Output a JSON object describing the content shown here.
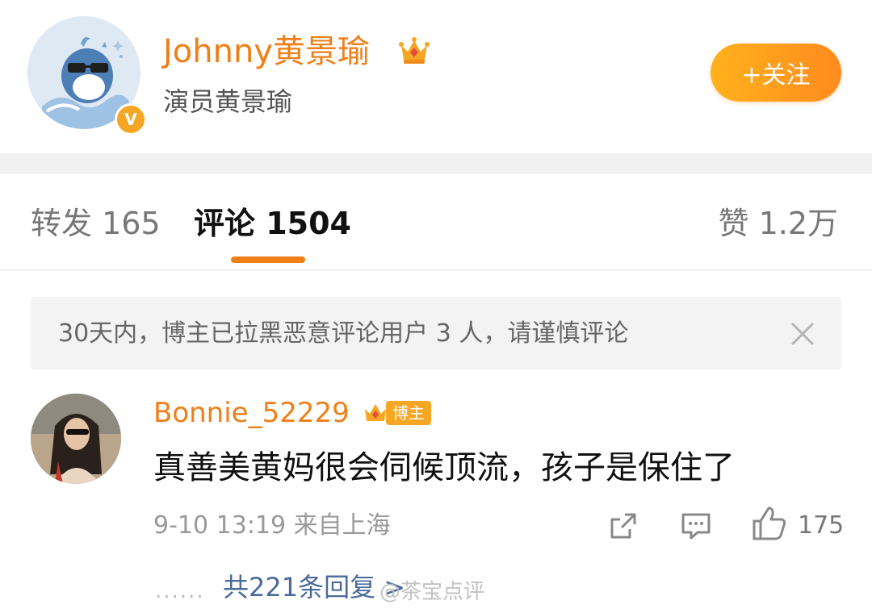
{
  "header": {
    "username": "Johnny黄景瑜",
    "subtitle": "演员黄景瑜",
    "verified_mark": "V",
    "follow_label": "+关注"
  },
  "tabs": [
    {
      "label": "转发 165"
    },
    {
      "label": "评论 1504"
    },
    {
      "label": "赞 1.2万"
    }
  ],
  "notice": {
    "text": "30天内，博主已拉黑恶意评论用户 3 人，请谨慎评论"
  },
  "comment": {
    "author": "Bonnie_52229",
    "author_badge": "博主",
    "text": "真善美黄妈很会伺候顶流，孩子是保住了",
    "meta": "9-10 13:19 来自上海",
    "likes": "175",
    "replies_dots": "......",
    "replies_link": "共221条回复 >"
  },
  "watermark": "@茶宝点评",
  "colors": {
    "accent": "#f07f18",
    "link": "#4a6b9a",
    "follow_gradient_start": "#ffb11c",
    "follow_gradient_end": "#ff8b1f"
  }
}
